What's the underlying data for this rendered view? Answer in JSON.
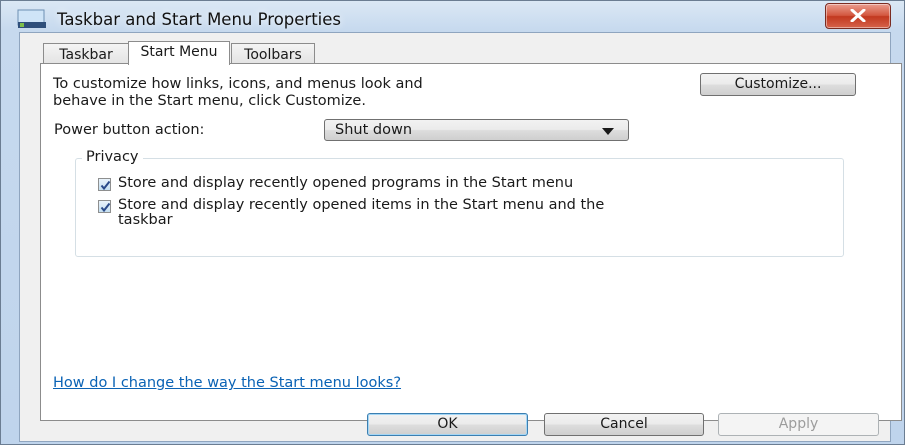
{
  "window": {
    "title": "Taskbar and Start Menu Properties"
  },
  "tabs": [
    {
      "label": "Taskbar"
    },
    {
      "label": "Start Menu"
    },
    {
      "label": "Toolbars"
    }
  ],
  "start_menu": {
    "intro_line1": "To customize how links, icons, and menus look and",
    "intro_line2": "behave in the Start menu, click Customize.",
    "customize_label": "Customize...",
    "power_label": "Power button action:",
    "power_value": "Shut down",
    "privacy_legend": "Privacy",
    "privacy_items": [
      {
        "label": "Store and display recently opened programs in the Start menu",
        "checked": true
      },
      {
        "label_line1": "Store and display recently opened items in the Start menu and the",
        "label_line2": "taskbar",
        "checked": true
      }
    ],
    "help_link": "How do I change the way the Start menu looks?"
  },
  "buttons": {
    "ok": "OK",
    "cancel": "Cancel",
    "apply": "Apply"
  },
  "icons": {
    "title": "taskbar-icon",
    "close": "close-icon",
    "dropdown": "chevron-down-icon",
    "check": "checkmark-icon"
  },
  "colors": {
    "close_button": "#c2381f",
    "link": "#0b63b5",
    "frame": "#bfd4ec"
  }
}
